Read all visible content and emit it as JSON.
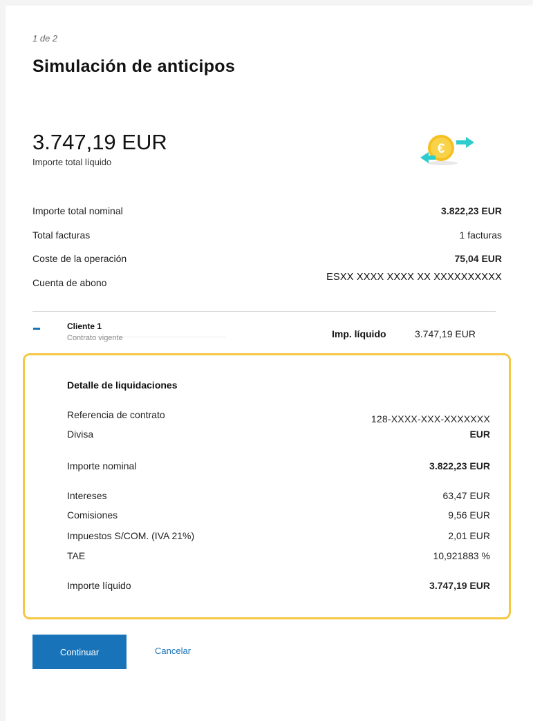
{
  "header": {
    "step": "1 de 2",
    "title": "Simulación de anticipos"
  },
  "summary": {
    "total_amount": "3.747,19 EUR",
    "total_label": "Importe total líquido",
    "icon": "euro-transfer-icon",
    "rows": [
      {
        "label": "Importe total nominal",
        "value": "3.822,23 EUR"
      },
      {
        "label": "Total facturas",
        "value": "1 facturas"
      },
      {
        "label": "Coste de la operación",
        "value": "75,04 EUR"
      },
      {
        "label": "Cuenta de abono",
        "value": "ESXX XXXX XXXX XX XXXXXXXXXX"
      }
    ]
  },
  "client": {
    "name": "Cliente 1",
    "status": "Contrato vigente",
    "imp_label": "Imp. líquido",
    "imp_value": "3.747,19 EUR"
  },
  "detail": {
    "heading": "Detalle de liquidaciones",
    "rows": [
      {
        "label": "Referencia de contrato",
        "value": "128-XXXX-XXX-XXXXXXX"
      },
      {
        "label": "Divisa",
        "value": "EUR"
      },
      {
        "label": "Importe nominal",
        "value": "3.822,23 EUR"
      },
      {
        "label": "Intereses",
        "value": "63,47 EUR"
      },
      {
        "label": "Comisiones",
        "value": "9,56 EUR"
      },
      {
        "label": "Impuestos S/COM. (IVA 21%)",
        "value": "2,01 EUR"
      },
      {
        "label": "TAE",
        "value": "10,921883 %"
      },
      {
        "label": "Importe líquido",
        "value": "3.747,19 EUR"
      }
    ]
  },
  "actions": {
    "continue_label": "Continuar",
    "cancel_label": "Cancelar"
  },
  "colors": {
    "primary": "#1973b8",
    "highlight_border": "#f7c742",
    "icon_coin": "#f5c021",
    "icon_arrows": "#2dcccd"
  }
}
